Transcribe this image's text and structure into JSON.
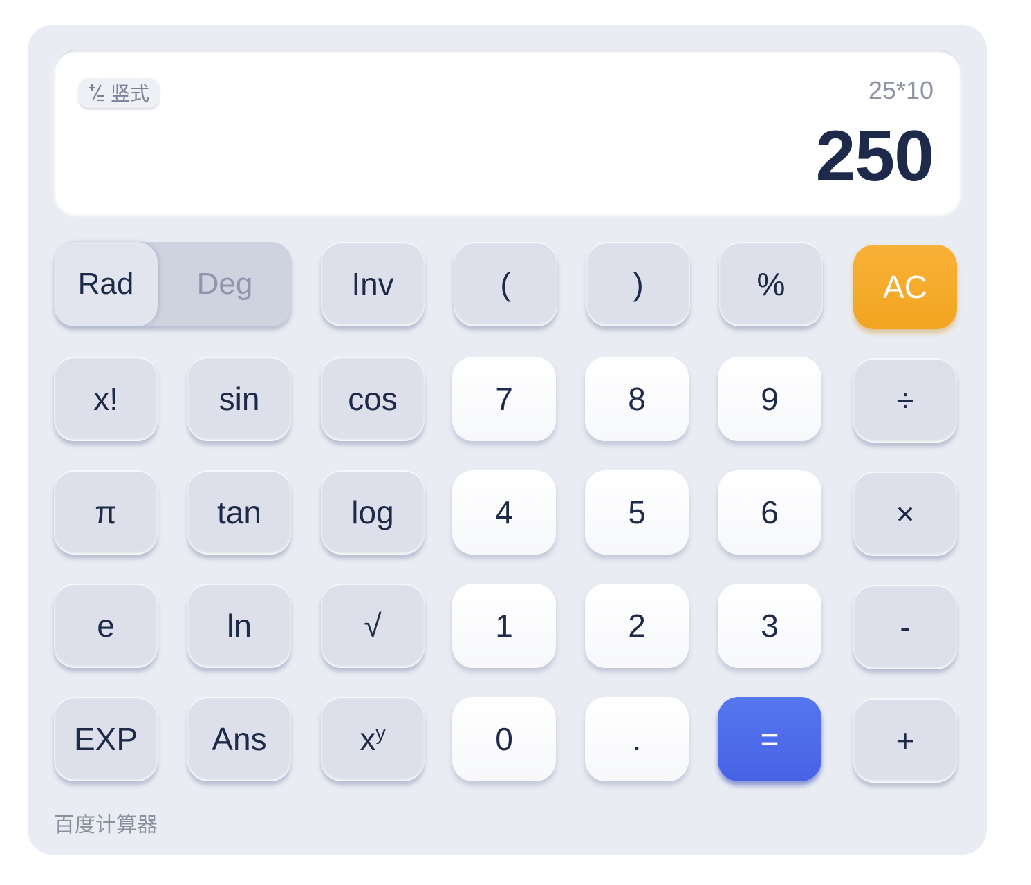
{
  "display": {
    "mode_toggle_label": "竖式",
    "expression": "25*10",
    "result": "250"
  },
  "angle_mode": {
    "rad_label": "Rad",
    "deg_label": "Deg",
    "selected": "Rad"
  },
  "keys": {
    "inv": "Inv",
    "lparen": "(",
    "rparen": ")",
    "percent": "%",
    "ac": "AC",
    "factorial": "x!",
    "sin": "sin",
    "cos": "cos",
    "seven": "7",
    "eight": "8",
    "nine": "9",
    "divide": "÷",
    "pi": "π",
    "tan": "tan",
    "log": "log",
    "four": "4",
    "five": "5",
    "six": "6",
    "multiply": "×",
    "e": "e",
    "ln": "ln",
    "sqrt": "√",
    "one": "1",
    "two": "2",
    "three": "3",
    "minus": "-",
    "exp": "EXP",
    "ans": "Ans",
    "power_base": "x",
    "power_exp": "y",
    "zero": "0",
    "dot": ".",
    "equals": "=",
    "plus": "+"
  },
  "footer": {
    "brand": "百度计算器"
  },
  "colors": {
    "accent_ac": "#f5a623",
    "accent_equals": "#4a68e8",
    "text_dark": "#1e2a4a"
  }
}
